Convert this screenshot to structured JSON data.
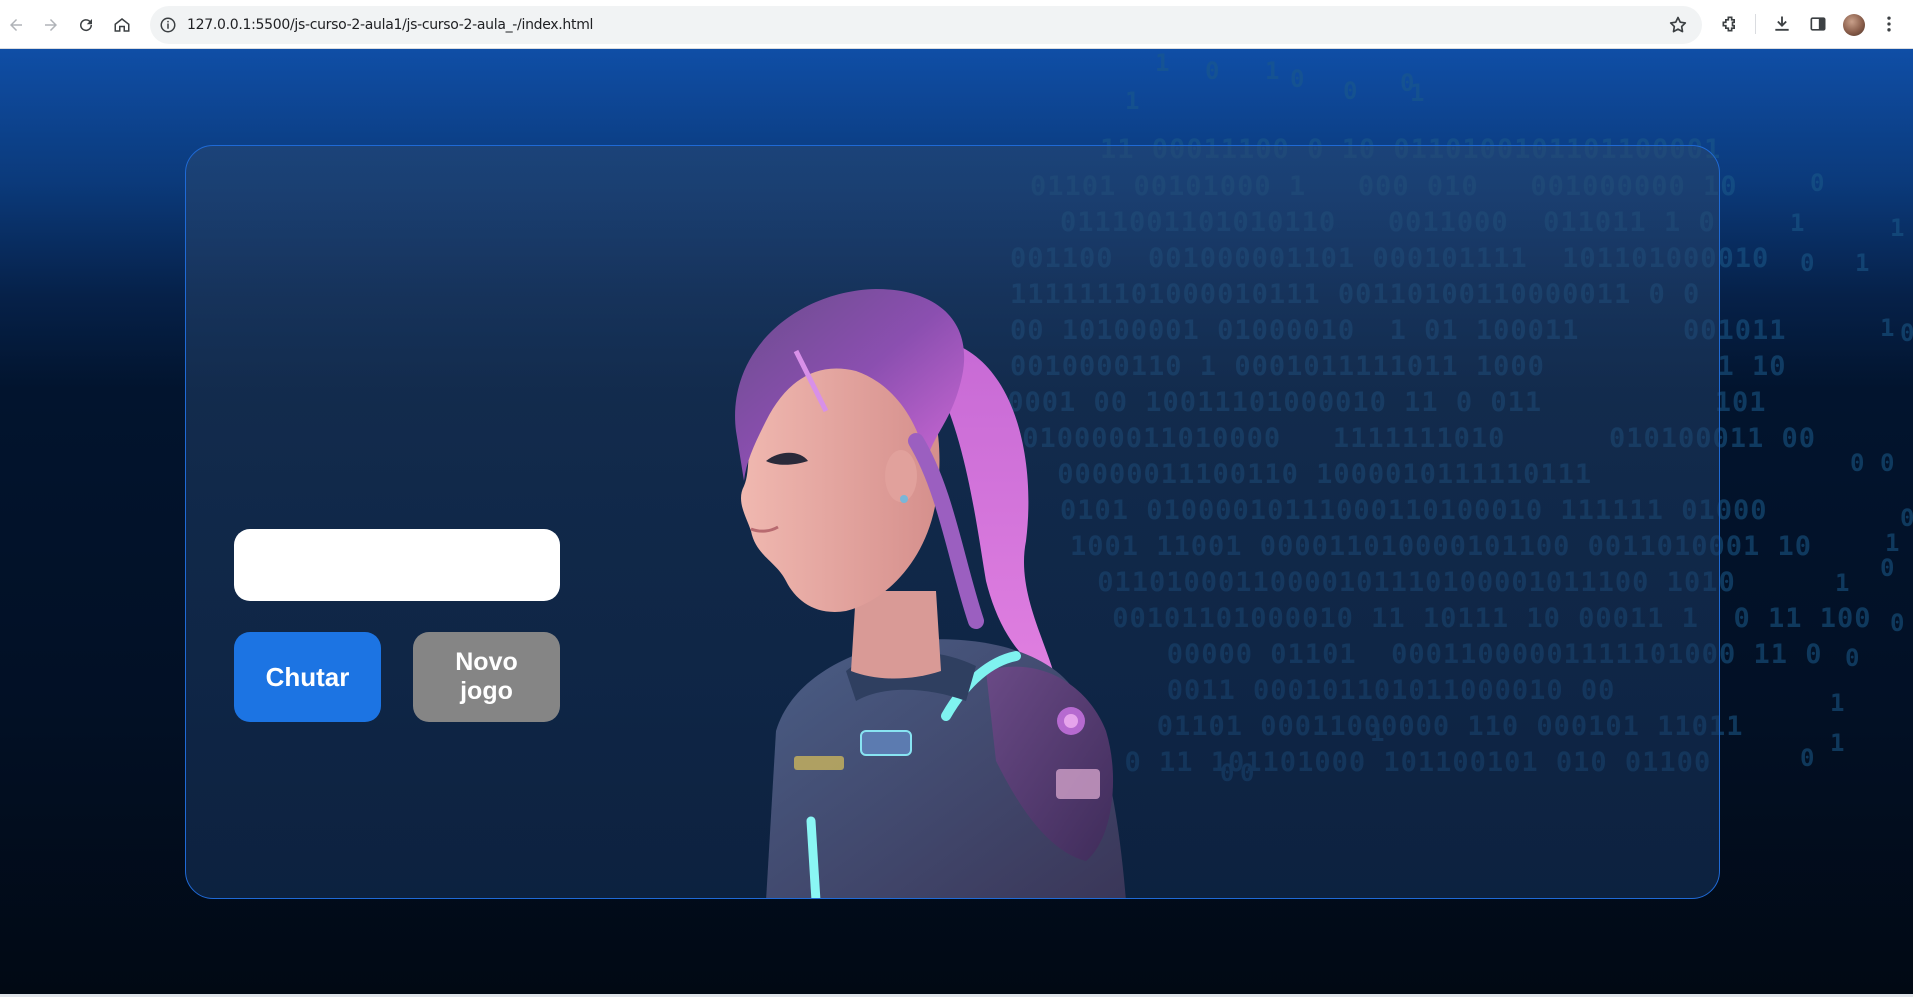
{
  "browser": {
    "url": "127.0.0.1:5500/js-curso-2-aula1/js-curso-2-aula_-/index.html"
  },
  "game": {
    "input_value": "",
    "input_placeholder": "",
    "guess_button_label": "Chutar",
    "new_game_button_label": "Novo jogo"
  },
  "colors": {
    "accent": "#1c74e3",
    "secondary_button": "#858585",
    "card_border": "#1f6ad6",
    "binary_text": "#1b5a8a"
  },
  "background_binary": {
    "rows": [
      "11 00011100 0 10 0110100101101100001",
      "01101 00101000 1   000 010   001000000 10",
      "0111001101010110   0011000  011011 1 0",
      "001100  001000001101 000101111  101101000010",
      "111111101000010111 00110100110000011 0 0",
      "00 10100001 01000010  1 01 100011      001011",
      "0010000110 1 0001011111011 1000          1 10",
      "10001 00 10011101000010 11 0 011          101",
      "0010000011010000   1111111010      010100011 00",
      " 00000011100110 1000010111110111",
      "0101 01000010111000110100010 111111 01000",
      "1001 11001 000011010000101100 0011010001 10",
      " 01101000110000101110100001011100 1010",
      " 00101101000010 11 10111 10 00011 1  0 11 100",
      "   00000 01101  00011000001111101000 11 0",
      "   0011 000101101011000010 00",
      "   01101 00011000000 110 000101 11011",
      "  0 11 101101000 101100101 010 01100"
    ],
    "digits": [
      "1",
      "0",
      "1",
      "0",
      "0",
      "1",
      "0",
      "1",
      "0",
      "0",
      "1",
      "1",
      "0",
      "1",
      "0",
      "1",
      "0",
      "0",
      "1",
      "0",
      "1",
      "0",
      "1",
      "0",
      "0",
      "1",
      "1",
      "0",
      "1",
      "0",
      "1",
      "1",
      "0",
      "0",
      "0",
      "1",
      "0",
      "1"
    ]
  }
}
